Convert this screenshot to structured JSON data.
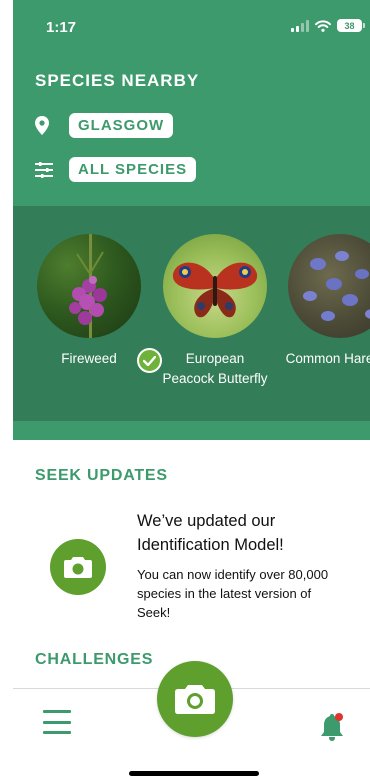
{
  "status": {
    "time": "1:17",
    "battery": "38"
  },
  "header": {
    "title": "SPECIES NEARBY",
    "location": "GLASGOW",
    "species_filter": "ALL SPECIES"
  },
  "species": [
    {
      "name": "Fireweed",
      "observed": true
    },
    {
      "name": "European Peacock Butterfly",
      "observed": false
    },
    {
      "name": "Common Harebell",
      "observed": false
    }
  ],
  "updates": {
    "section_title": "SEEK UPDATES",
    "title": "We’ve updated our Identification Model!",
    "body": "You can now identify over 80,000 species in the latest version of Seek!"
  },
  "challenges": {
    "section_title": "CHALLENGES"
  },
  "colors": {
    "primary": "#3d9a6c",
    "carousel": "#337e59",
    "accent": "#5e9f2e",
    "notification": "#e0342f"
  },
  "icons": {
    "location": "map-pin-icon",
    "filter": "sliders-icon",
    "observed": "check-icon",
    "menu": "menu-icon",
    "camera": "camera-icon",
    "notifications": "bell-icon"
  }
}
